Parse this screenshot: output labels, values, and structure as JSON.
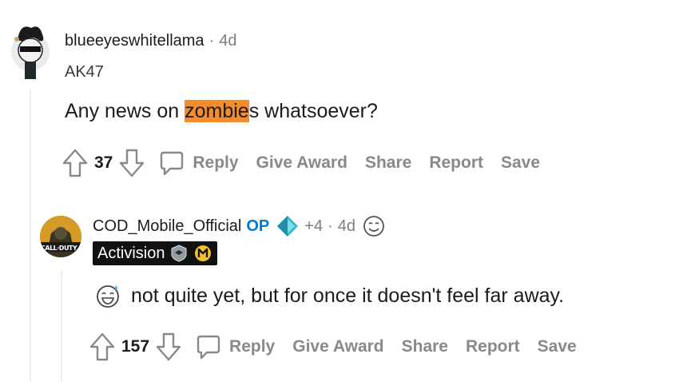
{
  "comment1": {
    "username": "blueeyeswhitellama",
    "time": "4d",
    "flair": "AK47",
    "body_before": "Any news on ",
    "body_highlight": "zombie",
    "body_after": "s whatsoever?",
    "score": "37",
    "actions": {
      "reply": "Reply",
      "award": "Give Award",
      "share": "Share",
      "report": "Report",
      "save": "Save"
    }
  },
  "comment2": {
    "username": "COD_Mobile_Official",
    "op_label": "OP",
    "awards": "+4",
    "time": "4d",
    "avatar_text": "CALL·DUTY",
    "flair": "Activision",
    "body": "not quite yet, but for once it doesn't feel far away.",
    "score": "157",
    "actions": {
      "reply": "Reply",
      "award": "Give Award",
      "share": "Share",
      "report": "Report",
      "save": "Save"
    }
  },
  "colors": {
    "op": "#0079d3",
    "highlight": "#f68b2b",
    "muted": "#878a8c"
  }
}
